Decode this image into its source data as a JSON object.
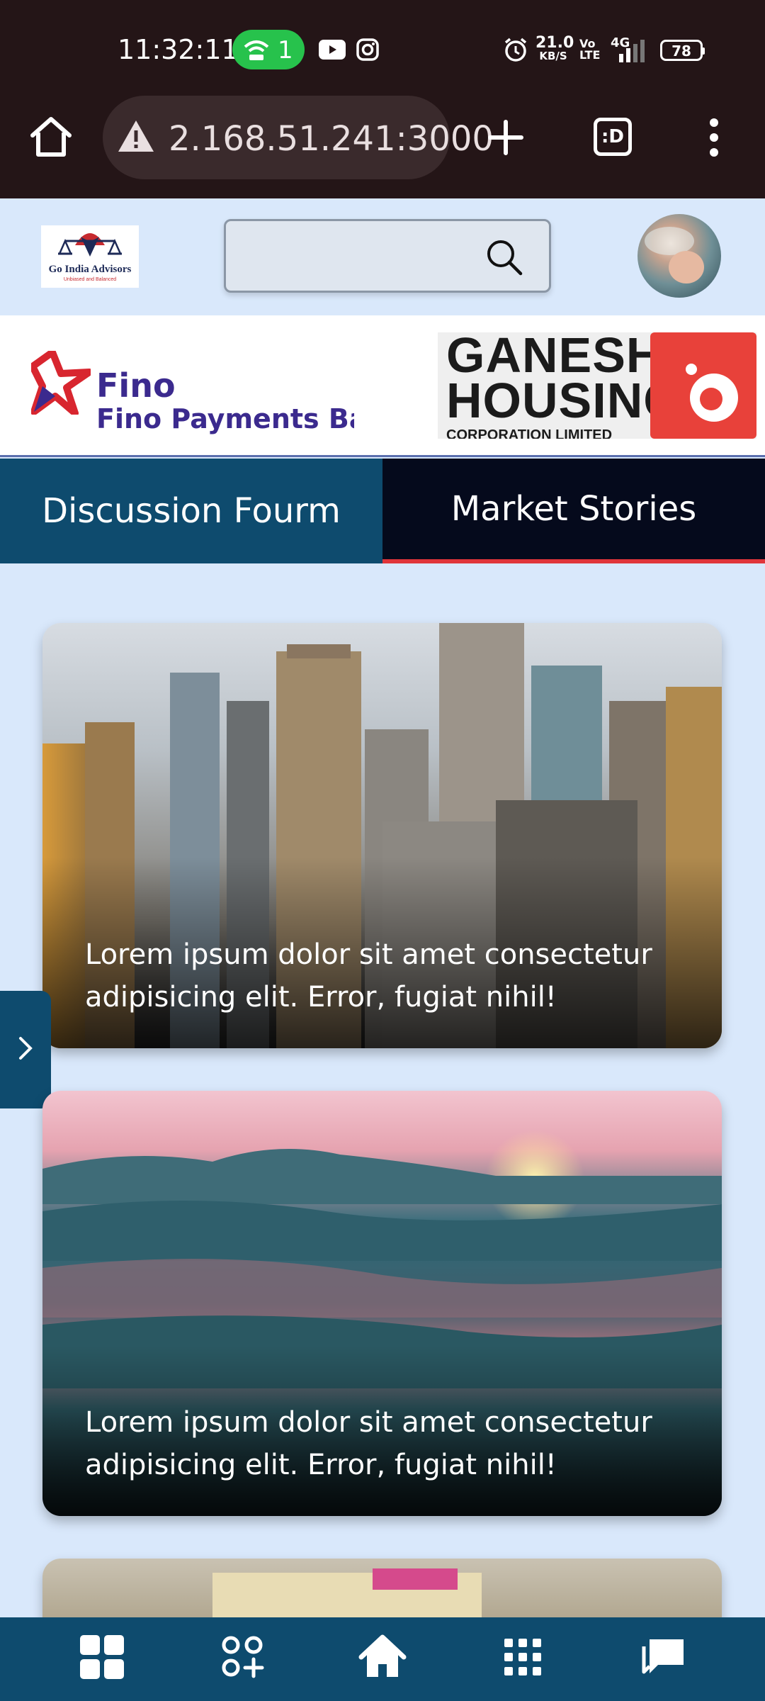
{
  "status_bar": {
    "time": "11:32:11",
    "hotspot_count": "1",
    "net_speed_value": "21.0",
    "net_speed_unit": "KB/S",
    "volte_line1": "Vo",
    "volte_line2": "LTE",
    "network_type": "4G",
    "battery": "78"
  },
  "browser": {
    "url": "2.168.51.241:3000",
    "tab_switcher_label": ":D"
  },
  "header": {
    "logo_title": "Go India Advisors",
    "logo_tagline": "Unbiased and Balanced",
    "search_placeholder": ""
  },
  "ad_banner": {
    "ad1_brand": "Fino",
    "ad1_name": "Fino Payments Bank",
    "ad2_line1": "GANESH",
    "ad2_line2": "HOUSING",
    "ad2_line3": "CORPORATION LIMITED"
  },
  "tabs": [
    {
      "label": "Discussion Fourm",
      "active": false
    },
    {
      "label": "Market Stories",
      "active": true
    }
  ],
  "stories": [
    {
      "caption": "Lorem ipsum dolor sit amet consectetur adipisicing elit. Error, fugiat nihil!"
    },
    {
      "caption": "Lorem ipsum dolor sit amet consectetur adipisicing elit. Error, fugiat nihil!"
    }
  ],
  "bottom_nav": [
    {
      "icon": "dashboard-icon"
    },
    {
      "icon": "add-widget-icon"
    },
    {
      "icon": "home-icon"
    },
    {
      "icon": "apps-grid-icon"
    },
    {
      "icon": "chat-icon"
    }
  ],
  "colors": {
    "browser_chrome": "#241517",
    "page_bg": "#d9e8fb",
    "tab_inactive": "#0e4b6e",
    "tab_active": "#050a1c",
    "tab_active_underline": "#e0353a",
    "bottom_nav": "#0e4b6e",
    "hotspot_badge": "#27c24c"
  }
}
